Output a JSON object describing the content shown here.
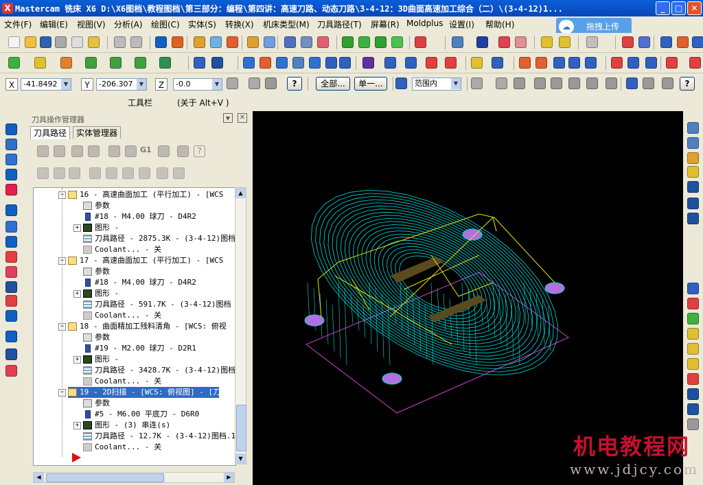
{
  "window": {
    "title": "Mastercam 铣床 X6   D:\\X6图档\\教程图档\\第三部分：编程\\第四讲：高速刀路、动态刀路\\3-4-12：3D曲面高速加工综合（二）\\(3-4-12)1...",
    "app_icon": "X"
  },
  "menu": [
    "文件(F)",
    "编辑(E)",
    "视图(V)",
    "分析(A)",
    "绘图(C)",
    "实体(S)",
    "转换(X)",
    "机床类型(M)",
    "刀具路径(T)",
    "屏幕(R)",
    "Moldplus",
    "设置(I)",
    "帮助(H)"
  ],
  "upload": {
    "label": "拖拽上传"
  },
  "coords": {
    "x_label": "X",
    "x_value": "-41.8492",
    "y_label": "Y",
    "y_value": "-206.307",
    "z_label": "Z",
    "z_value": "-0.0",
    "help_btn": "?"
  },
  "select": {
    "all_btn": "全部...",
    "single_btn": "单一...",
    "range_value": "范围内"
  },
  "toolbar_title": {
    "label": "工具栏",
    "hint": "(关于 Alt+V )"
  },
  "panel": {
    "title": "刀具操作管理器",
    "tabs": [
      "刀具路径",
      "实体管理器"
    ],
    "tree": [
      {
        "text": "16 - 高速曲面加工 (平行加工) - [WCS",
        "type": "op"
      },
      {
        "text": "参数",
        "type": "param"
      },
      {
        "text": "#18 - M4.00 球刀 - D4R2",
        "type": "tool"
      },
      {
        "text": "图形 -",
        "type": "geo"
      },
      {
        "text": "刀具路径 - 2875.3K - (3-4-12)图档",
        "type": "path"
      },
      {
        "text": "Coolant... - 关",
        "type": "coolant"
      },
      {
        "text": "17 - 高速曲面加工 (平行加工) - [WCS",
        "type": "op"
      },
      {
        "text": "参数",
        "type": "param"
      },
      {
        "text": "#18 - M4.00 球刀 - D4R2",
        "type": "tool"
      },
      {
        "text": "图形 -",
        "type": "geo"
      },
      {
        "text": "刀具路径 - 591.7K - (3-4-12)图档",
        "type": "path"
      },
      {
        "text": "Coolant... - 关",
        "type": "coolant"
      },
      {
        "text": "18 - 曲面精加工残料清角 - [WCS: 俯视",
        "type": "op"
      },
      {
        "text": "参数",
        "type": "param"
      },
      {
        "text": "#19 - M2.00 球刀 - D2R1",
        "type": "tool"
      },
      {
        "text": "图形 -",
        "type": "geo"
      },
      {
        "text": "刀具路径 - 3428.7K - (3-4-12)图档",
        "type": "path"
      },
      {
        "text": "Coolant... - 关",
        "type": "coolant"
      },
      {
        "text": "19 - 2D扫描 - [WCS: 俯视图] - [刀具",
        "type": "op",
        "selected": true
      },
      {
        "text": "参数",
        "type": "param"
      },
      {
        "text": "#5 - M6.00 平底刀 - D6R0",
        "type": "tool"
      },
      {
        "text": "图形 - (3) 串连(s)",
        "type": "geo"
      },
      {
        "text": "刀具路径 - 12.7K - (3-4-12)图档.1",
        "type": "path"
      },
      {
        "text": "Coolant... - 关",
        "type": "coolant"
      }
    ],
    "toolbar1": [
      "G1"
    ]
  },
  "watermark": {
    "text": "机电教程网",
    "url": "www.jdjcy.com"
  },
  "colors": {
    "toolpath": "#00e0e0",
    "rapid": "#e8e800",
    "stock": "#d040d0",
    "accent": "#c8102e"
  }
}
